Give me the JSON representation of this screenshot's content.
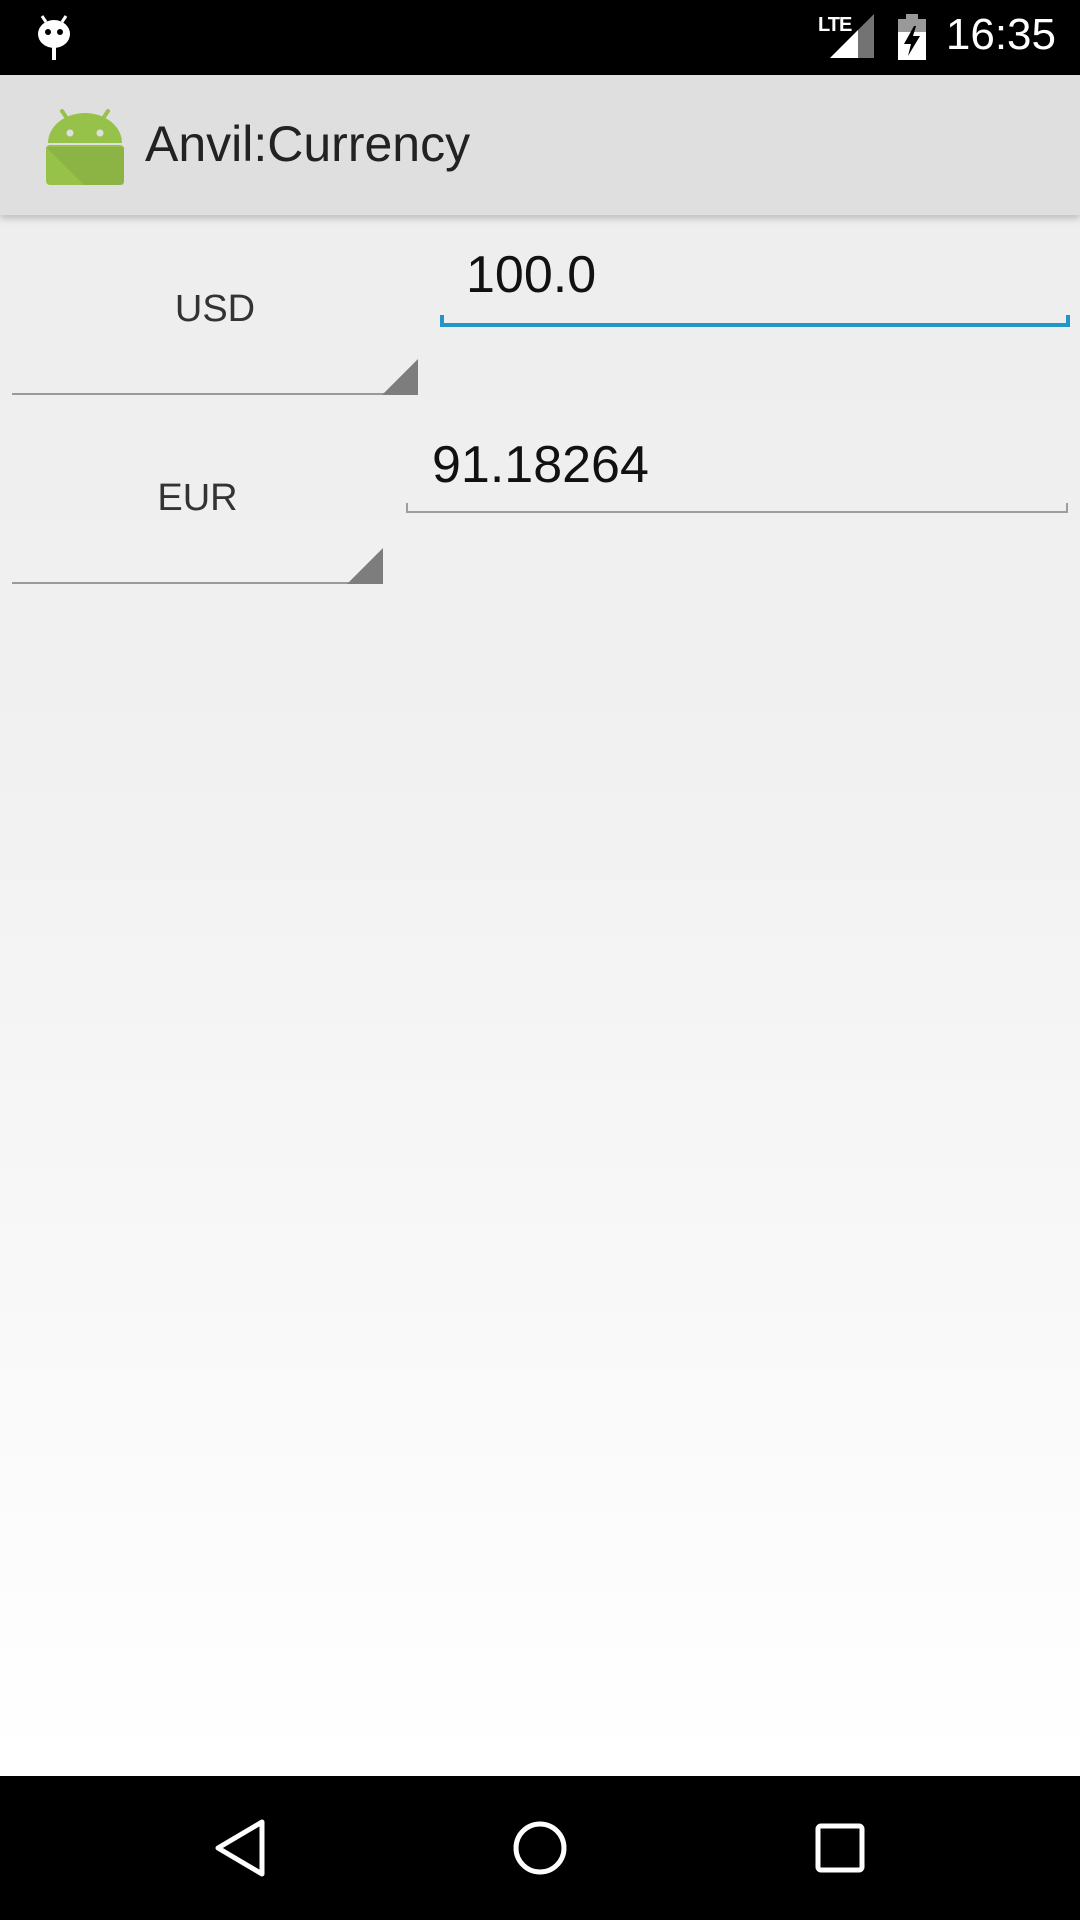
{
  "status_bar": {
    "notification_icon": "android-debug-icon",
    "network_label": "LTE",
    "battery_icon": "battery-charging-icon",
    "time": "16:35"
  },
  "action_bar": {
    "app_icon": "android-robot-icon",
    "title": "Anvil:Currency"
  },
  "converter": {
    "rows": [
      {
        "currency": "USD",
        "amount": "100.0",
        "focused": true
      },
      {
        "currency": "EUR",
        "amount": "91.18264",
        "focused": false
      }
    ]
  },
  "nav_bar": {
    "back_icon": "back-icon",
    "home_icon": "home-icon",
    "recents_icon": "recents-icon"
  },
  "colors": {
    "accent": "#2196c8",
    "status_bar": "#000000",
    "action_bar": "#dfdfdf",
    "android_green": "#97c24a"
  }
}
